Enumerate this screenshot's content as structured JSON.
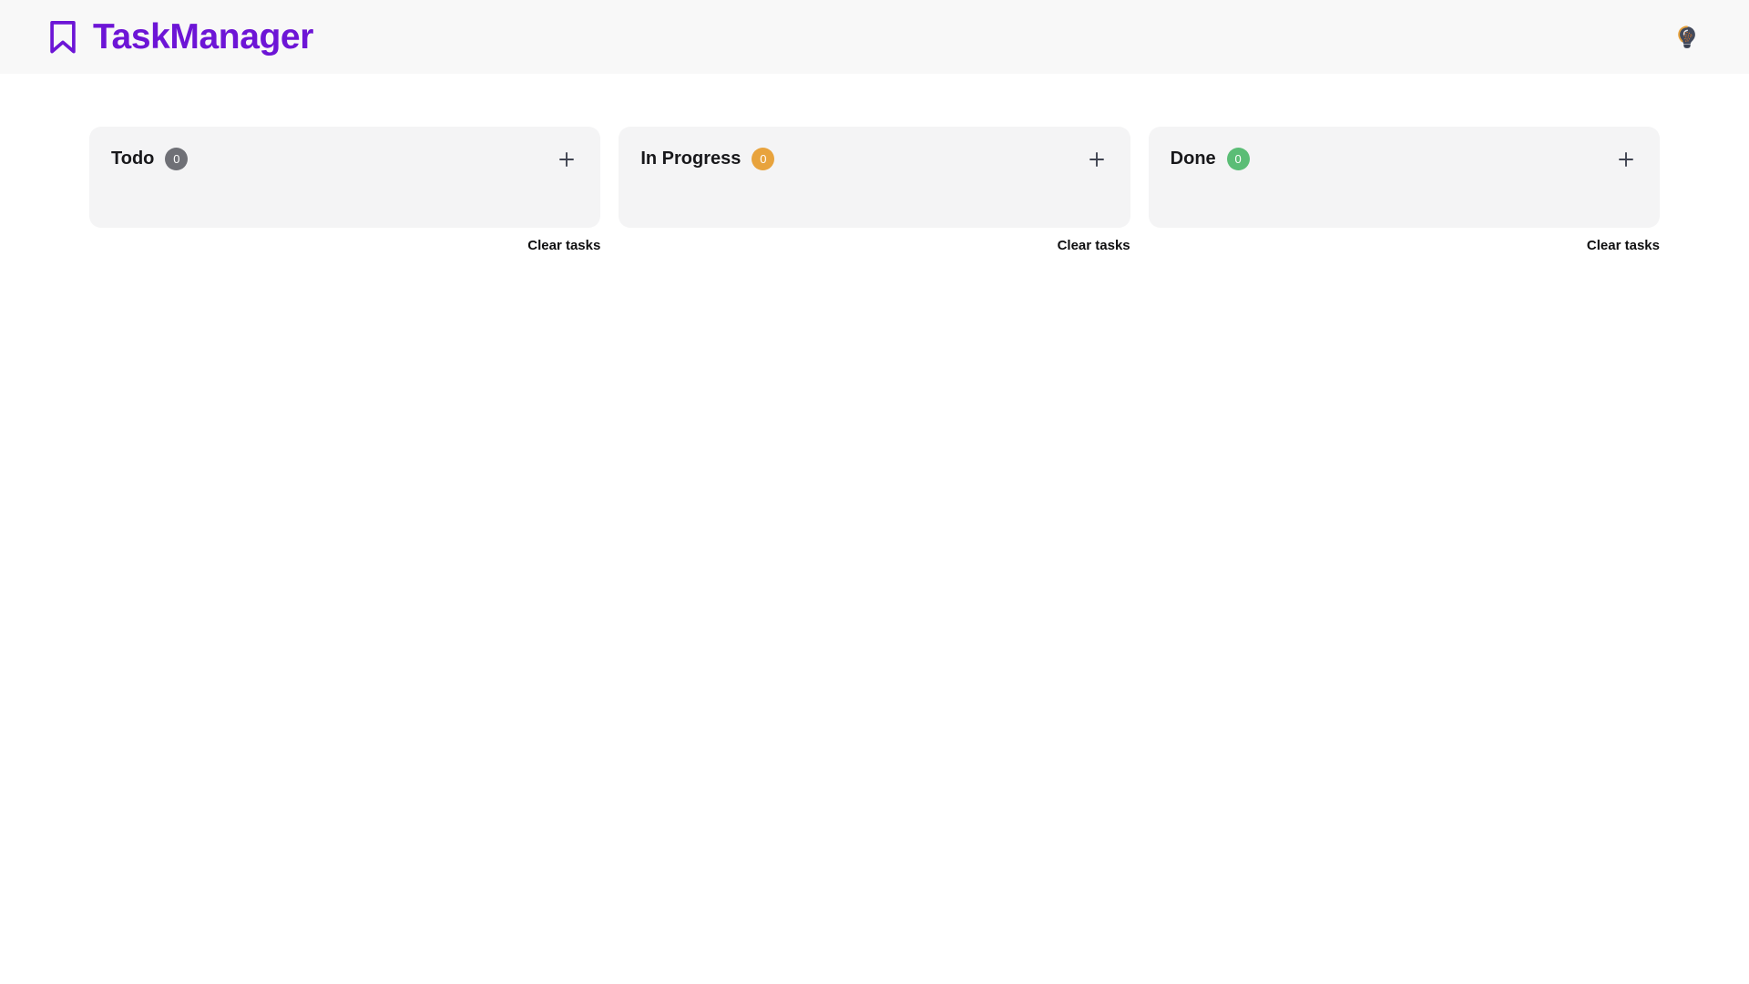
{
  "header": {
    "logo_icon": "bookmark-icon",
    "title": "TaskManager",
    "theme_toggle_icon": "lightbulb-icon",
    "background_color": "#f8f8f8",
    "brand_color": "#6d15d6"
  },
  "board": {
    "columns": [
      {
        "title": "Todo",
        "count": "0",
        "badge_color": "#6f7076",
        "add_icon": "plus-icon",
        "clear_label": "Clear tasks",
        "tasks": []
      },
      {
        "title": "In Progress",
        "count": "0",
        "badge_color": "#e8a33d",
        "add_icon": "plus-icon",
        "clear_label": "Clear tasks",
        "tasks": []
      },
      {
        "title": "Done",
        "count": "0",
        "badge_color": "#5bbd76",
        "add_icon": "plus-icon",
        "clear_label": "Clear tasks",
        "tasks": []
      }
    ]
  }
}
